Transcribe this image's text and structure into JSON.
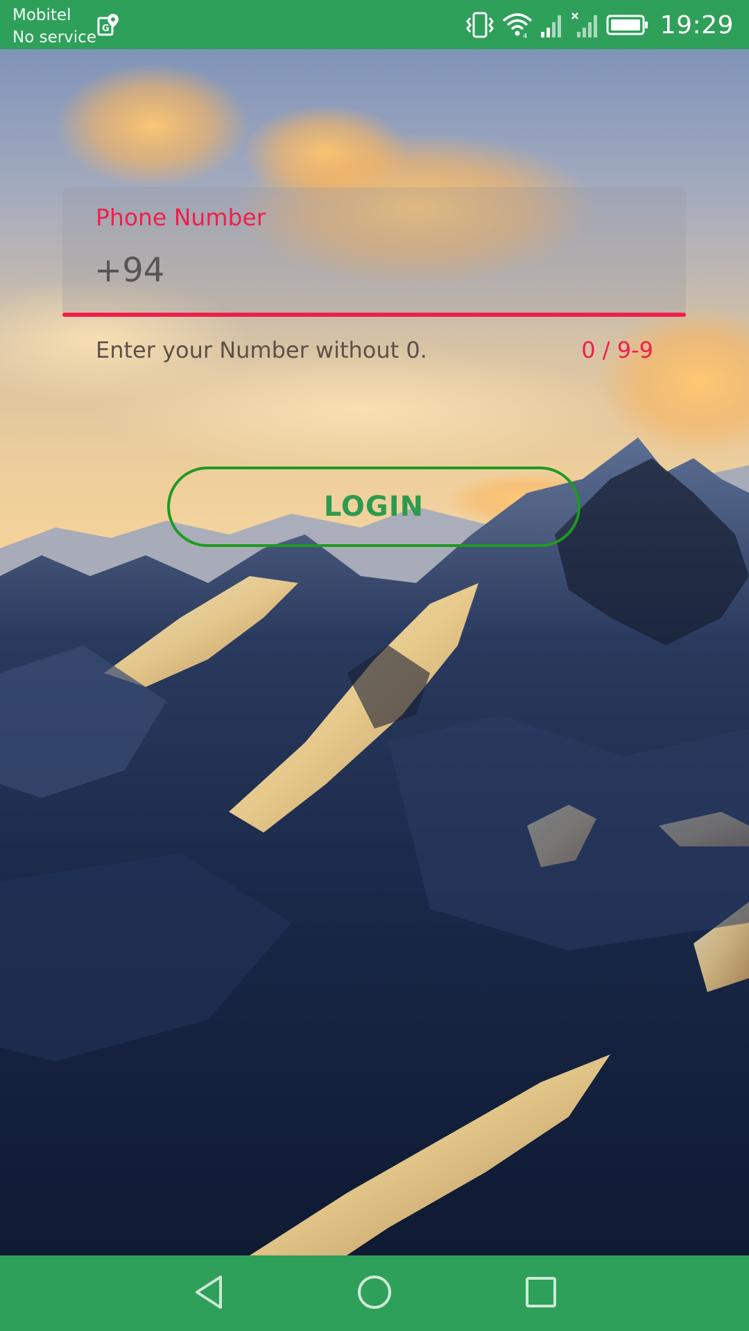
{
  "status_bar": {
    "carrier_name": "Mobitel",
    "carrier_status": "No service",
    "time": "19:29",
    "icons": [
      "maps-location-icon",
      "vibrate-icon",
      "wifi-icon",
      "signal-icon",
      "no-signal-icon",
      "battery-icon"
    ]
  },
  "login_form": {
    "field_label": "Phone Number",
    "phone_placeholder": "+94",
    "phone_value": "",
    "helper_text": "Enter your Number without 0.",
    "char_counter": "0 / 9-9",
    "login_label": "LOGIN"
  },
  "navigation": {
    "icons": [
      "back-icon",
      "home-icon",
      "recents-icon"
    ]
  },
  "colors": {
    "status_bar": "#2ea05a",
    "nav_bar": "#2ea05a",
    "accent_error": "#f01e4c",
    "button_border": "#1e9a22",
    "button_text": "#2e9a4e"
  }
}
